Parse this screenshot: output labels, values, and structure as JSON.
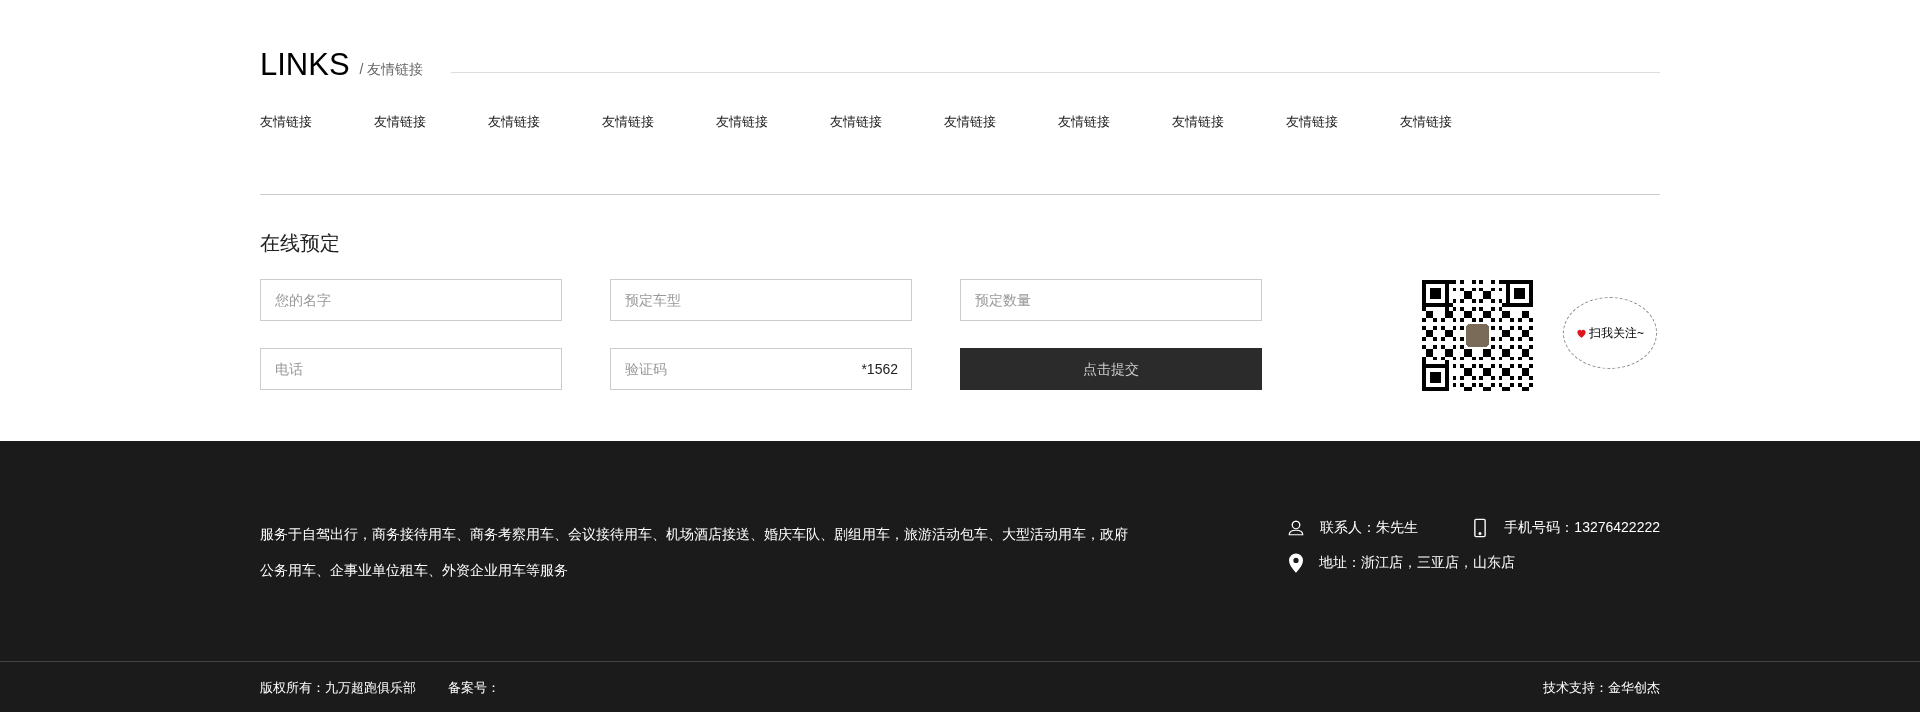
{
  "links_section": {
    "title": "LINKS",
    "subtitle": "/ 友情链接",
    "links": [
      "友情链接",
      "友情链接",
      "友情链接",
      "友情链接",
      "友情链接",
      "友情链接",
      "友情链接",
      "友情链接",
      "友情链接",
      "友情链接",
      "友情链接"
    ]
  },
  "booking": {
    "title": "在线预定",
    "fields": [
      {
        "placeholder": "您的名字"
      },
      {
        "placeholder": "预定车型"
      },
      {
        "placeholder": "预定数量"
      },
      {
        "placeholder": "电话"
      },
      {
        "placeholder": "验证码",
        "code": "*1562"
      }
    ],
    "submit": "点击提交",
    "qr_bubble": "扫我关注~"
  },
  "footer": {
    "services": "服务于自驾出行，商务接待用车、商务考察用车、会议接待用车、机场酒店接送、婚庆车队、剧组用车，旅游活动包车、大型活动用车，政府公务用车、企事业单位租车、外资企业用车等服务",
    "contact": "联系人：朱先生",
    "phone": "手机号码：13276422222",
    "address": "地址：浙江店，三亚店，山东店"
  },
  "bottom_bar": {
    "copyright": "版权所有：九万超跑俱乐部",
    "record": "备案号：",
    "support": "技术支持：金华创杰"
  }
}
